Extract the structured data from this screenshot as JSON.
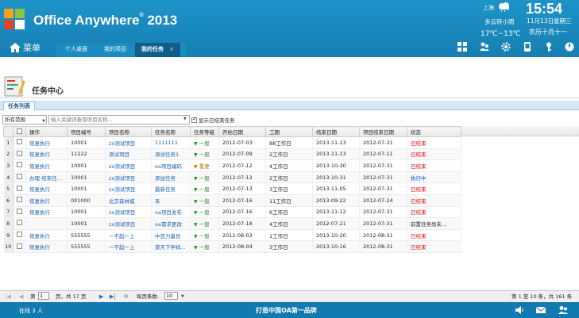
{
  "header": {
    "title": "Office Anywhere",
    "title_reg": "®",
    "title_year": "2013",
    "weather": {
      "city": "上海",
      "condition": "多云转小雨",
      "temp": "17℃~13℃"
    },
    "time": "15:54",
    "date": "11月13日星期三",
    "lunar": "农历十月十一",
    "menu_label": "菜单",
    "tabs": [
      {
        "label": "个人桌面",
        "active": false
      },
      {
        "label": "我的项目",
        "active": false
      },
      {
        "label": "我的任务",
        "active": true,
        "close": "×"
      }
    ]
  },
  "page": {
    "title": "任务中心",
    "tab_label": "任务列表"
  },
  "toolbar": {
    "scope": "所有范围",
    "search_placeholder": "输入关键词查询项目名称...",
    "show_ended_label": "显示已结束任务"
  },
  "grid": {
    "columns": [
      "",
      "",
      "操作",
      "项目编号",
      "项目名称",
      "任务名称",
      "任务等级",
      "开始日期",
      "工期",
      "结束日期",
      "项目结束日期",
      "状态"
    ],
    "rows": [
      {
        "n": "1",
        "op": "恢复执行",
        "code": "10001",
        "project": "zx测试项目",
        "task": "1111111",
        "level": "一般",
        "start": "2012-07-03",
        "dur": "88工作日",
        "end": "2013-11-13",
        "pend": "2012-07-31",
        "status": "已结束",
        "st": "end"
      },
      {
        "n": "2",
        "op": "恢复执行",
        "code": "11222",
        "project": "测试项目",
        "task": "测试任务1",
        "level": "一般",
        "start": "2012-07-09",
        "dur": "2工作日",
        "end": "2013-11-13",
        "pend": "2012-07-11",
        "status": "已结束",
        "st": "end"
      },
      {
        "n": "3",
        "op": "恢复执行",
        "code": "10001",
        "project": "zx测试项目",
        "task": "oa项目编码",
        "level": "重要",
        "start": "2012-07-12",
        "dur": "4工作日",
        "end": "2013-10-30",
        "pend": "2012-07-31",
        "status": "已结束",
        "st": "end"
      },
      {
        "n": "4",
        "op": "办理 结束任...",
        "code": "10001",
        "project": "zx测试项目",
        "task": "添加任务",
        "level": "一般",
        "start": "2012-07-12",
        "dur": "2工作日",
        "end": "2013-10-31",
        "pend": "2012-07-31",
        "status": "执行中",
        "st": "run"
      },
      {
        "n": "5",
        "op": "恢复执行",
        "code": "10001",
        "project": "zx测试项目",
        "task": "最新任务",
        "level": "一般",
        "start": "2012-07-13",
        "dur": "3工作日",
        "end": "2013-11-05",
        "pend": "2012-07-31",
        "status": "已结束",
        "st": "end"
      },
      {
        "n": "6",
        "op": "恢复执行",
        "code": "001000",
        "project": "北京森林城",
        "task": "禾",
        "level": "一般",
        "start": "2012-07-16",
        "dur": "11工作日",
        "end": "2013-09-22",
        "pend": "2012-07-24",
        "status": "已结束",
        "st": "end"
      },
      {
        "n": "7",
        "op": "恢复执行",
        "code": "10001",
        "project": "zx测试项目",
        "task": "oa项目发布",
        "level": "一般",
        "start": "2012-07-16",
        "dur": "6工作日",
        "end": "2013-11-12",
        "pend": "2012-07-31",
        "status": "已结束",
        "st": "end"
      },
      {
        "n": "8",
        "op": "",
        "code": "10001",
        "project": "zx测试项目",
        "task": "oa需求更改",
        "level": "一般",
        "start": "2012-07-18",
        "dur": "4工作日",
        "end": "2012-07-21",
        "pend": "2012-07-31",
        "status": "前置任务尚未...",
        "st": "pre"
      },
      {
        "n": "9",
        "op": "恢复执行",
        "code": "555555",
        "project": "一不起一上",
        "task": "中亚力量员",
        "level": "一般",
        "start": "2012-08-03",
        "dur": "1工作日",
        "end": "2013-10-20",
        "pend": "2012-08-31",
        "status": "已结束",
        "st": "end"
      },
      {
        "n": "10",
        "op": "恢复执行",
        "code": "555555",
        "project": "一不起一上",
        "task": "菜天下亭样...",
        "level": "一般",
        "start": "2012-08-04",
        "dur": "3工作日",
        "end": "2013-10-16",
        "pend": "2012-08-31",
        "status": "已结束",
        "st": "end"
      }
    ]
  },
  "pager": {
    "page_prefix": "第",
    "page": "1",
    "page_suffix": "页，共 17 页",
    "per_page_label": "每页条数:",
    "per_page": "10",
    "summary": "第 1 至 10 条，共 161 条"
  },
  "footer": {
    "online": "在线 3 人",
    "slogan": "打造中国OA第一品牌"
  },
  "colors": {
    "header": "#1d93c8",
    "footer": "#117ab0",
    "ended": "#dd0000",
    "running": "#0044cc",
    "link": "#1a5fb4"
  }
}
